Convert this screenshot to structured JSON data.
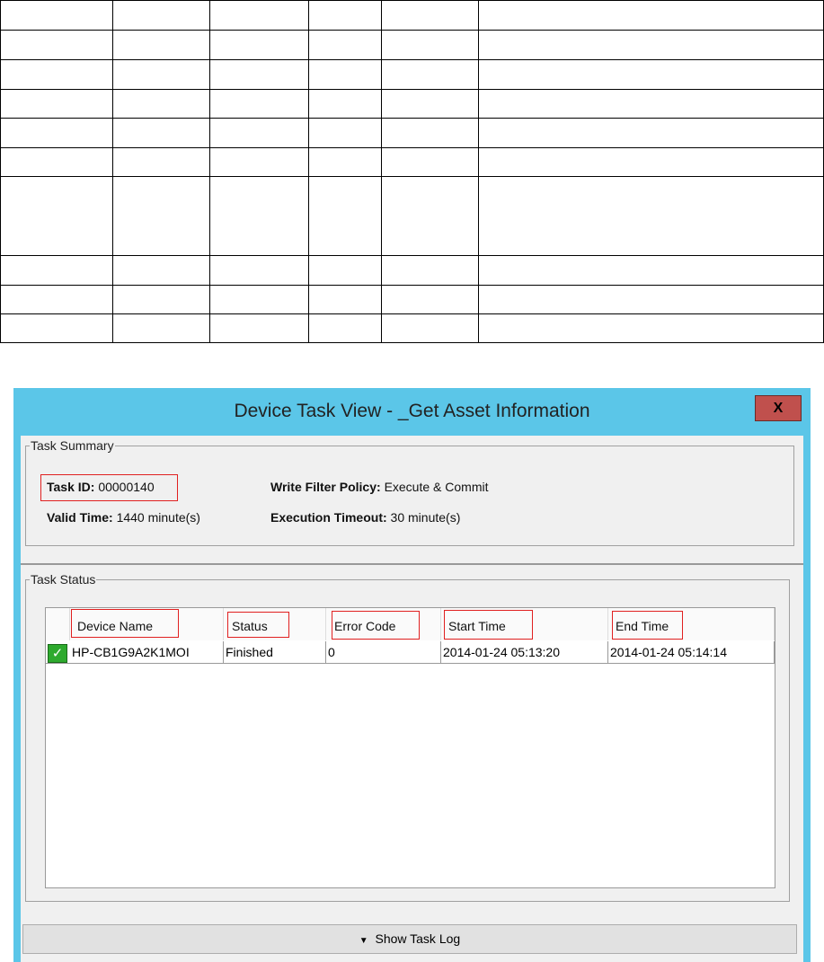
{
  "dialog": {
    "title": "Device Task View - _Get Asset Information",
    "close_label": "X"
  },
  "summary": {
    "legend": "Task Summary",
    "task_id_label": "Task ID:",
    "task_id": "00000140",
    "valid_time_label": "Valid Time:",
    "valid_time": "1440 minute(s)",
    "write_filter_label": "Write Filter Policy:",
    "write_filter": "Execute & Commit",
    "timeout_label": "Execution Timeout:",
    "timeout": "30 minute(s)"
  },
  "status": {
    "legend": "Task Status",
    "columns": [
      "Device Name",
      "Status",
      "Error Code",
      "Start Time",
      "End Time"
    ],
    "rows": [
      {
        "device": "HP-CB1G9A2K1MOI",
        "status": "Finished",
        "error_code": "0",
        "start": "2014-01-24 05:13:20",
        "end": "2014-01-24 05:14:14"
      }
    ]
  },
  "show_log_label": "Show Task Log",
  "colors": {
    "titlebar": "#5bc6e8",
    "close": "#c0504d",
    "highlight": "#e02020"
  }
}
